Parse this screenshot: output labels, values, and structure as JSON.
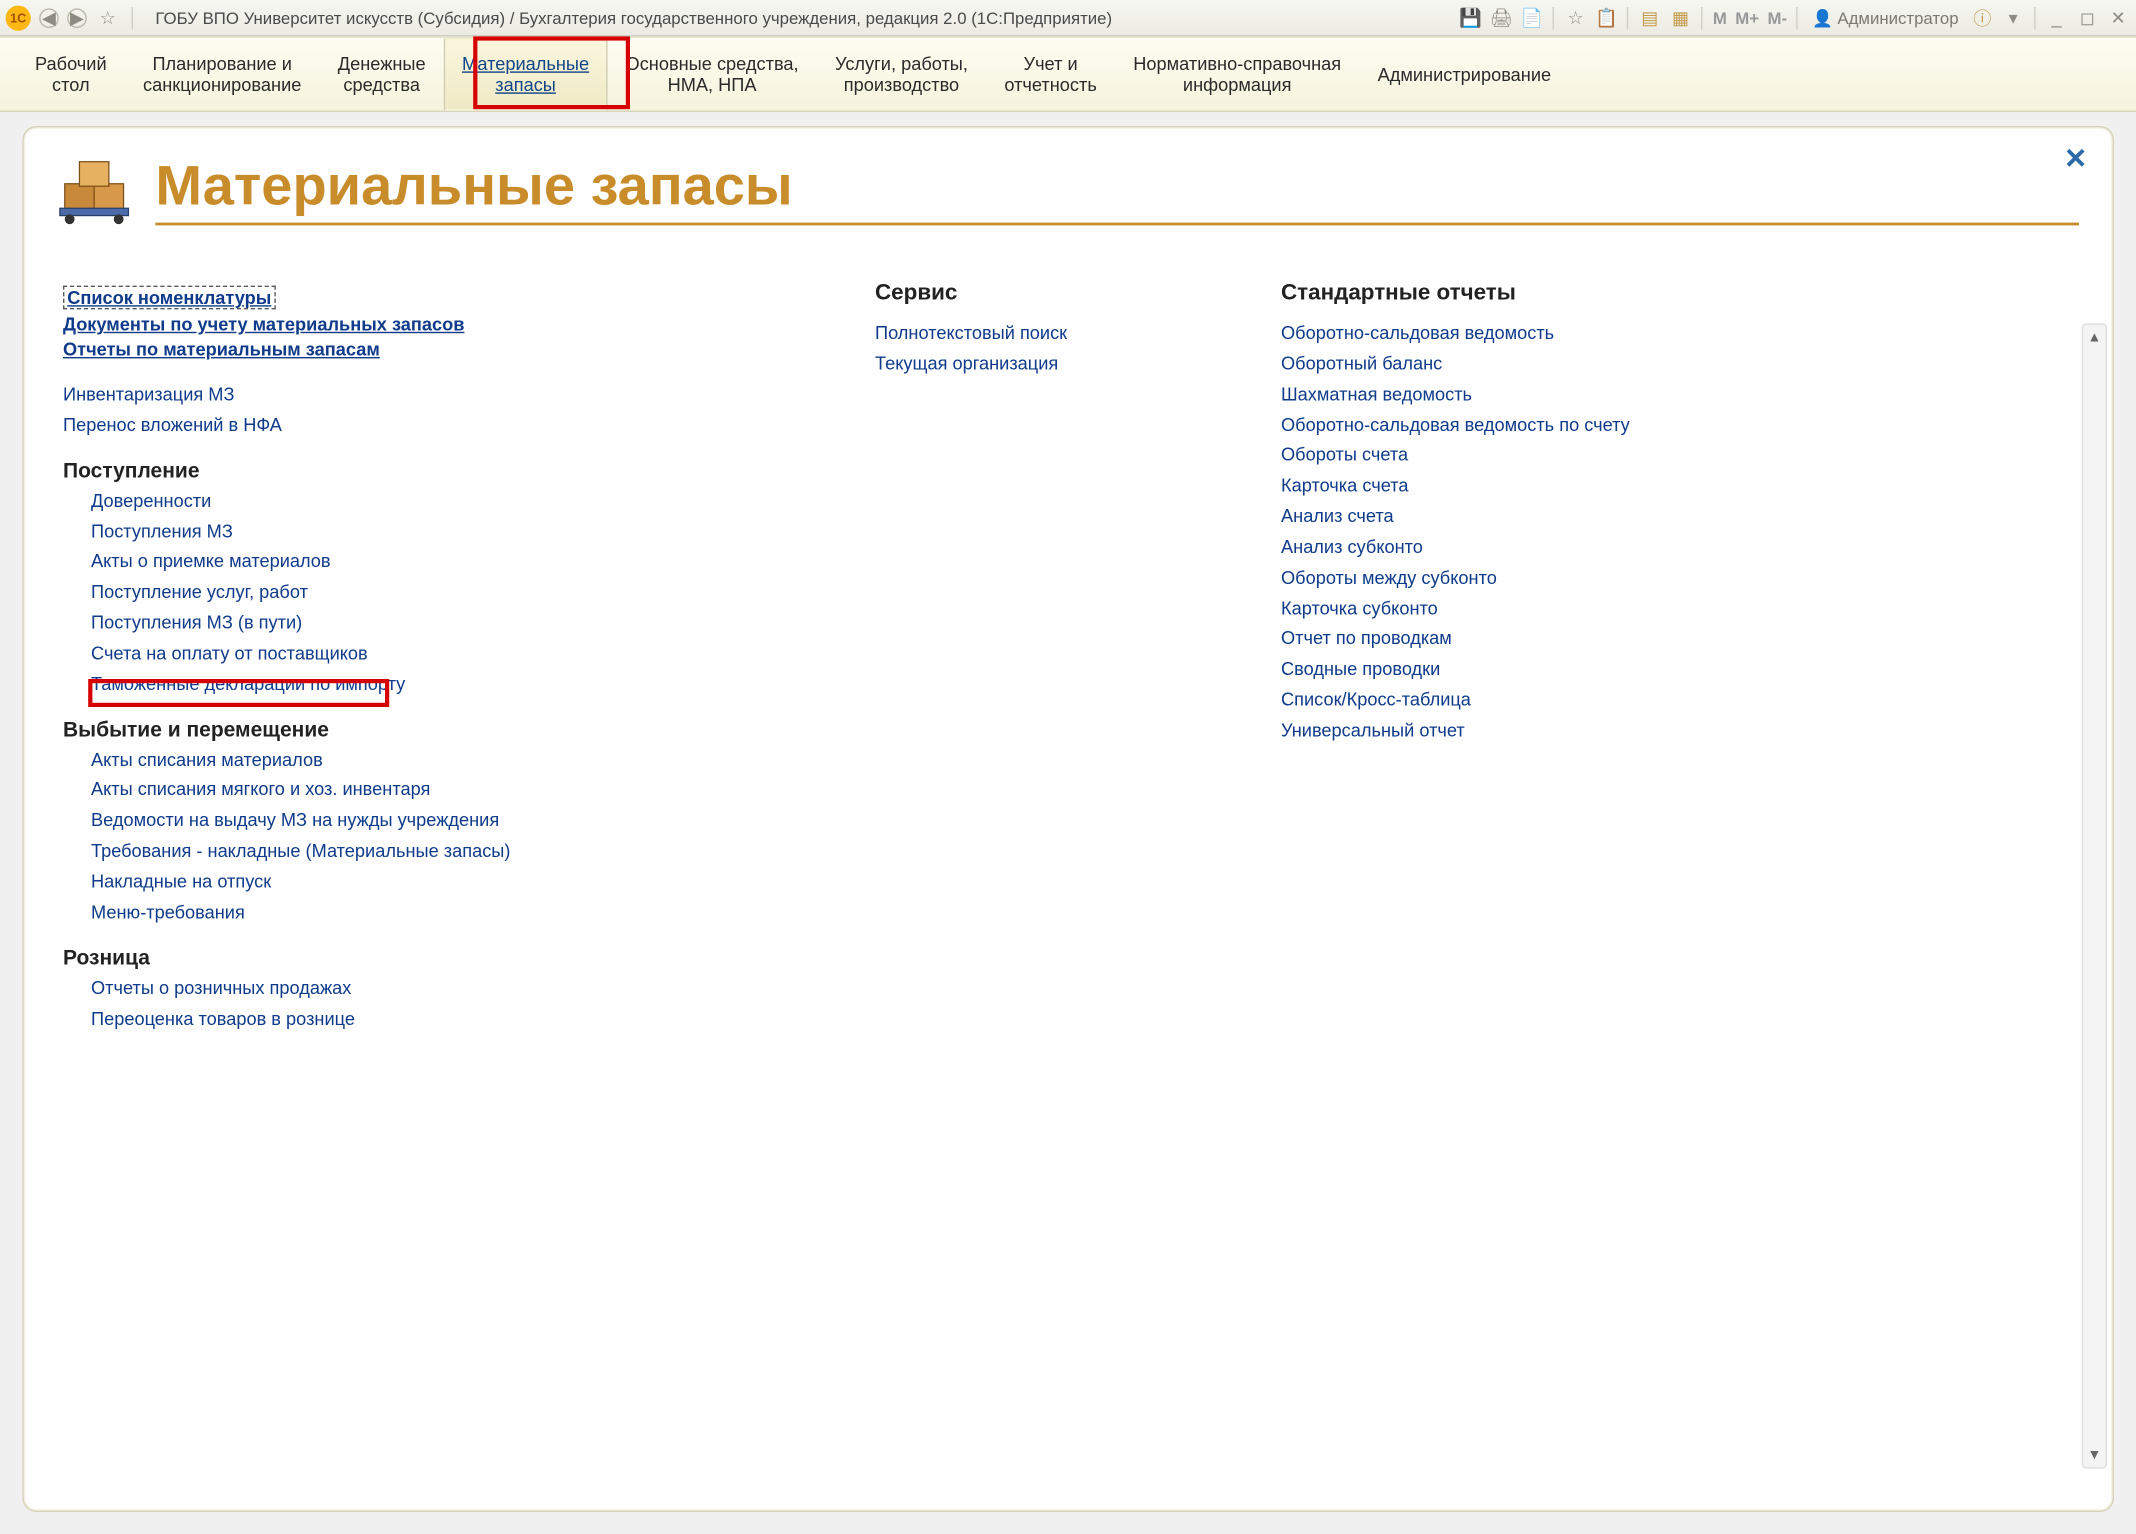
{
  "title": "ГОБУ ВПО Университет искусств (Субсидия) / Бухгалтерия государственного учреждения, редакция 2.0  (1С:Предприятие)",
  "user_label": "Администратор",
  "m_buttons": [
    "M",
    "M+",
    "M-"
  ],
  "nav": [
    {
      "l1": "Рабочий",
      "l2": "стол"
    },
    {
      "l1": "Планирование и",
      "l2": "санкционирование"
    },
    {
      "l1": "Денежные",
      "l2": "средства"
    },
    {
      "l1": "Материальные",
      "l2": "запасы",
      "active": true
    },
    {
      "l1": "Основные средства,",
      "l2": "НМА, НПА"
    },
    {
      "l1": "Услуги, работы,",
      "l2": "производство"
    },
    {
      "l1": "Учет и",
      "l2": "отчетность"
    },
    {
      "l1": "Нормативно-справочная",
      "l2": "информация"
    },
    {
      "l1": "Администрирование",
      "l2": ""
    }
  ],
  "page_heading": "Материальные запасы",
  "left": {
    "top_links": [
      "Список номенклатуры",
      "Документы по учету материальных запасов",
      "Отчеты по материальным запасам"
    ],
    "loose_links": [
      "Инвентаризация МЗ",
      "Перенос вложений в НФА"
    ],
    "group1_title": "Поступление",
    "group1_links": [
      "Доверенности",
      "Поступления МЗ",
      "Акты о приемке материалов",
      "Поступление услуг, работ",
      "Поступления МЗ (в пути)",
      "Счета на оплату от поставщиков",
      "Таможенные декларации по импорту"
    ],
    "group2_title": "Выбытие и перемещение",
    "group2_links": [
      "Акты списания материалов",
      "Акты списания мягкого и хоз. инвентаря",
      "Ведомости на выдачу МЗ на нужды учреждения",
      "Требования - накладные (Материальные запасы)",
      "Накладные на отпуск",
      "Меню-требования"
    ],
    "group3_title": "Розница",
    "group3_links": [
      "Отчеты о розничных продажах",
      "Переоценка товаров в рознице"
    ]
  },
  "mid": {
    "title": "Сервис",
    "links": [
      "Полнотекстовый поиск",
      "Текущая организация"
    ]
  },
  "right": {
    "title": "Стандартные отчеты",
    "links": [
      "Оборотно-сальдовая ведомость",
      "Оборотный баланс",
      "Шахматная ведомость",
      "Оборотно-сальдовая ведомость по счету",
      "Обороты счета",
      "Карточка счета",
      "Анализ счета",
      "Анализ субконто",
      "Обороты между субконто",
      "Карточка субконто",
      "Отчет по проводкам",
      "Сводные проводки",
      "Список/Кросс-таблица",
      "Универсальный отчет"
    ]
  }
}
